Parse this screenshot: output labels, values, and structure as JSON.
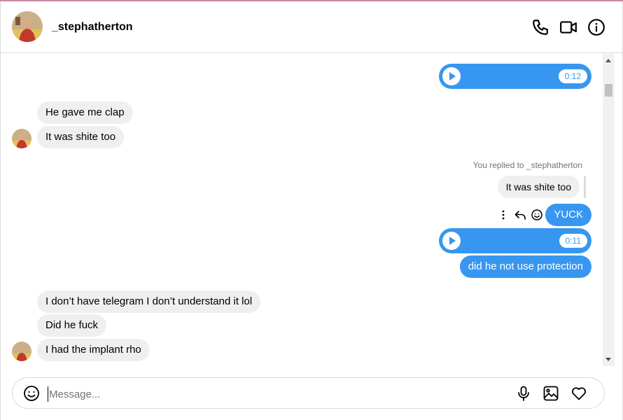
{
  "colors": {
    "accent": "#3797f0",
    "incoming_bubble": "#efefef",
    "border": "#dbdbdb",
    "muted_text": "#737373"
  },
  "header": {
    "username": "_stephatherton",
    "icons": [
      "phone-icon",
      "video-call-icon",
      "info-icon"
    ]
  },
  "messages": [
    {
      "type": "voice",
      "direction": "out",
      "duration": "0:12"
    },
    {
      "type": "text",
      "direction": "in",
      "text": "He gave me clap"
    },
    {
      "type": "text",
      "direction": "in",
      "text": "It was shite too"
    },
    {
      "type": "reply",
      "direction": "out",
      "caption": "You replied to _stephatherton",
      "quoted": "It was shite too",
      "text": "YUCK"
    },
    {
      "type": "voice",
      "direction": "out",
      "duration": "0:11"
    },
    {
      "type": "text",
      "direction": "out",
      "text": "did he not use protection"
    },
    {
      "type": "text",
      "direction": "in",
      "text": "I don’t have telegram I don’t understand it lol"
    },
    {
      "type": "text",
      "direction": "in",
      "text": "Did he fuck"
    },
    {
      "type": "text",
      "direction": "in",
      "text": "I had the implant rho"
    }
  ],
  "hover_actions": [
    "more-options-icon",
    "reply-icon",
    "react-icon"
  ],
  "composer": {
    "placeholder": "Message...",
    "icons": [
      "emoji-icon",
      "microphone-icon",
      "image-icon",
      "heart-icon"
    ]
  }
}
